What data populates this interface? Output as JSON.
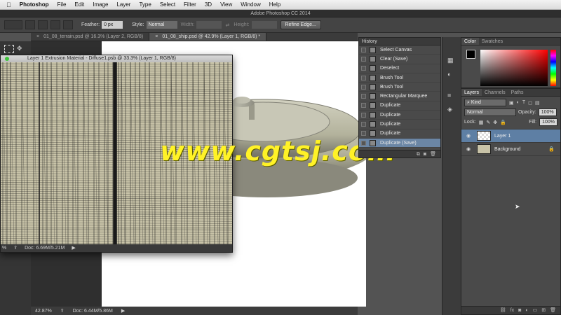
{
  "menubar": {
    "apple": "",
    "items": [
      "Photoshop",
      "File",
      "Edit",
      "Image",
      "Layer",
      "Type",
      "Select",
      "Filter",
      "3D",
      "View",
      "Window",
      "Help"
    ]
  },
  "titlebar": {
    "title": "Adobe Photoshop CC 2014"
  },
  "options": {
    "feather_label": "Feather:",
    "feather_value": "0 px",
    "style_label": "Style:",
    "style_value": "Normal",
    "width_label": "Width:",
    "height_label": "Height:",
    "refine_edge": "Refine Edge..."
  },
  "doctabs": [
    {
      "label": "01_08_terrain.psd @ 16.3% (Layer 2, RGB/8)",
      "close": "×"
    },
    {
      "label": "01_08_ship.psd @ 42.9% (Layer 1, RGB/8) *",
      "close": "×"
    }
  ],
  "float_window": {
    "title": "Layer 1 Extrusion Material - Diffuse1.psb @ 33.3% (Layer 1, RGB/8)",
    "zoom": "%",
    "doc": "Doc: 6.69M/5.21M"
  },
  "statusbar": {
    "zoom": "42.87%",
    "doc": "Doc: 6.44M/5.86M"
  },
  "watermark": "www.cgtsj.com",
  "history": {
    "title": "History",
    "items": [
      {
        "label": "Select Canvas",
        "selected": false
      },
      {
        "label": "Clear (Save)",
        "selected": false
      },
      {
        "label": "Deselect",
        "selected": false
      },
      {
        "label": "Brush Tool",
        "selected": false
      },
      {
        "label": "Brush Tool",
        "selected": false
      },
      {
        "label": "Rectangular Marquee",
        "selected": false
      },
      {
        "label": "Duplicate",
        "selected": false
      },
      {
        "label": "Duplicate",
        "selected": false
      },
      {
        "label": "Duplicate",
        "selected": false
      },
      {
        "label": "Duplicate",
        "selected": false
      },
      {
        "label": "Duplicate (Save)",
        "selected": true
      }
    ]
  },
  "color_panel": {
    "tabs": [
      "Color",
      "Swatches"
    ],
    "foreground": "#000000",
    "background": "#ffffff"
  },
  "layers_panel": {
    "tabs": [
      "Layers",
      "Channels",
      "Paths"
    ],
    "kind": "Kind",
    "blend": "Normal",
    "opacity_label": "Opacity:",
    "opacity": "100%",
    "lock_label": "Lock:",
    "fill_label": "Fill:",
    "fill": "100%",
    "layers": [
      {
        "name": "Layer 1",
        "selected": true,
        "thumb": "#e8e8e8"
      },
      {
        "name": "Background",
        "selected": false,
        "thumb": "#c8c3a8",
        "locked": true
      }
    ],
    "footer_icons": [
      "link-icon",
      "fx-icon",
      "mask-icon",
      "adjustment-icon",
      "folder-icon",
      "new-layer-icon",
      "trash-icon"
    ]
  },
  "colors": {
    "accent": "#5e7fa4",
    "watermark": "#fff227",
    "ship": "#b7b59e",
    "texture": "#c8c3a8"
  }
}
